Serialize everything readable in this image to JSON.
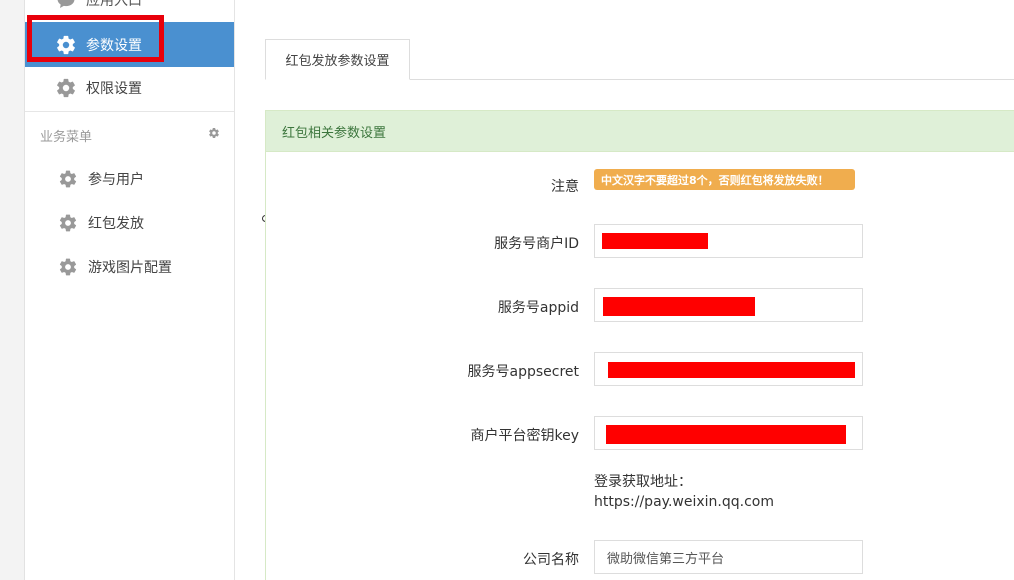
{
  "sidebar": {
    "top_item": {
      "label": "应用入口",
      "icon": "chat-bubble-icon"
    },
    "active_item": {
      "label": "参数设置",
      "icon": "gear-icon"
    },
    "perm_item": {
      "label": "权限设置",
      "icon": "gear-icon"
    },
    "group": {
      "label": "业务菜单",
      "icon": "gear-icon"
    },
    "sub_items": [
      {
        "label": "参与用户",
        "icon": "gear-icon"
      },
      {
        "label": "红包发放",
        "icon": "gear-icon"
      },
      {
        "label": "游戏图片配置",
        "icon": "gear-icon"
      }
    ]
  },
  "tabs": [
    {
      "label": "红包发放参数设置"
    }
  ],
  "panel": {
    "heading": "红包相关参数设置",
    "note_label": "注意",
    "note_text": "中文汉字不要超过8个，否则红包将发放失败！",
    "fields": [
      {
        "label": "服务号商户ID",
        "value": ""
      },
      {
        "label": "服务号appid",
        "value": ""
      },
      {
        "label": "服务号appsecret",
        "value": ""
      },
      {
        "label": "商户平台密钥key",
        "value": ""
      },
      {
        "label": "公司名称",
        "value": "微助微信第三方平台"
      }
    ],
    "help_line1": "登录获取地址：",
    "help_line2": "https://pay.weixin.qq.com"
  },
  "colors": {
    "sidebar_active": "#4a90d0",
    "highlight_border": "#e8000b",
    "panel_heading_bg": "#dff0d8",
    "warn_badge": "#f0ad4e",
    "redaction": "#ff0000"
  }
}
